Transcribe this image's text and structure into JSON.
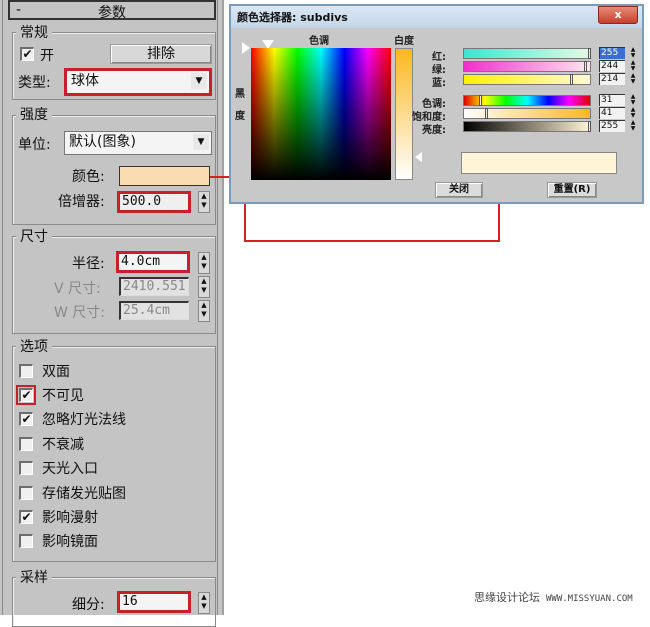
{
  "panel": {
    "rollout_title": "参数",
    "rollout_toggle": "-",
    "general": {
      "label": "常规",
      "on_checkbox": {
        "label": "开",
        "checked": true
      },
      "exclude_button": "排除",
      "type_label": "类型:",
      "type_value": "球体"
    },
    "intensity": {
      "label": "强度",
      "units_label": "单位:",
      "units_value": "默认(图象)",
      "color_label": "颜色:",
      "color_swatch": "#fbdcb2",
      "multiplier_label": "倍增器:",
      "multiplier_value": "500.0"
    },
    "size": {
      "label": "尺寸",
      "radius_label": "半径:",
      "radius_value": "4.0cm",
      "v_size_label": "V 尺寸:",
      "v_size_value": "2410.551",
      "w_size_label": "W 尺寸:",
      "w_size_value": "25.4cm"
    },
    "options": {
      "label": "选项",
      "items": [
        {
          "label": "双面",
          "checked": false
        },
        {
          "label": "不可见",
          "checked": true
        },
        {
          "label": "忽略灯光法线",
          "checked": true
        },
        {
          "label": "不衰减",
          "checked": false
        },
        {
          "label": "天光入口",
          "checked": false
        },
        {
          "label": "存储发光贴图",
          "checked": false
        },
        {
          "label": "影响漫射",
          "checked": true
        },
        {
          "label": "影响镜面",
          "checked": false
        }
      ]
    },
    "sampling": {
      "label": "采样",
      "subdivs_label": "细分:",
      "subdivs_value": "16"
    }
  },
  "color_dialog": {
    "title": "颜色选择器: subdivs",
    "close_glyph": "x",
    "hue_label": "色调",
    "whiteness_label": "白度",
    "blackness_label": "黑度",
    "channels": [
      {
        "label": "红:",
        "value": "255",
        "selected": true
      },
      {
        "label": "绿:",
        "value": "244"
      },
      {
        "label": "蓝:",
        "value": "214"
      },
      {
        "label": "色调:",
        "value": "31"
      },
      {
        "label": "饱和度:",
        "value": "41"
      },
      {
        "label": "亮度:",
        "value": "255"
      }
    ],
    "preview_color": "#fff4d6",
    "close_button": "关闭",
    "reset_button": "重置(R)"
  },
  "watermark": {
    "text": "思缘设计论坛",
    "url": "WWW.MISSYUAN.COM"
  }
}
